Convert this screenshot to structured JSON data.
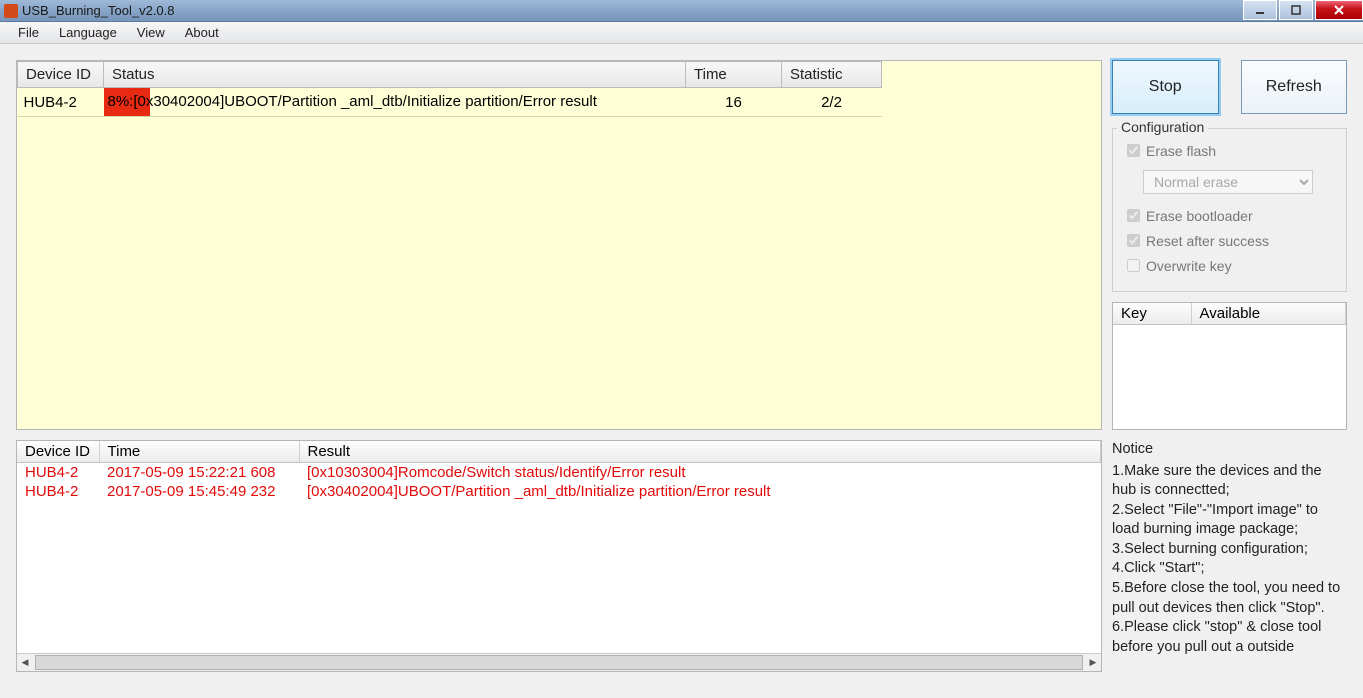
{
  "window": {
    "title": "USB_Burning_Tool_v2.0.8"
  },
  "menu": {
    "file": "File",
    "language": "Language",
    "view": "View",
    "about": "About"
  },
  "deviceTable": {
    "headers": {
      "id": "Device ID",
      "status": "Status",
      "time": "Time",
      "stat": "Statistic"
    },
    "row": {
      "id": "HUB4-2",
      "status": "8%:[0x30402004]UBOOT/Partition _aml_dtb/Initialize partition/Error result",
      "time": "16",
      "stat": "2/2",
      "progressPercent": "8"
    }
  },
  "logTable": {
    "headers": {
      "id": "Device ID",
      "time": "Time",
      "result": "Result"
    },
    "rows": [
      {
        "id": "HUB4-2",
        "time": "2017-05-09 15:22:21 608",
        "result": "[0x10303004]Romcode/Switch status/Identify/Error result"
      },
      {
        "id": "HUB4-2",
        "time": "2017-05-09 15:45:49 232",
        "result": "[0x30402004]UBOOT/Partition _aml_dtb/Initialize partition/Error result"
      }
    ]
  },
  "buttons": {
    "stop": "Stop",
    "refresh": "Refresh"
  },
  "config": {
    "legend": "Configuration",
    "eraseFlash": "Erase flash",
    "eraseMode": "Normal erase",
    "eraseBootloader": "Erase bootloader",
    "resetAfter": "Reset after success",
    "overwriteKey": "Overwrite key"
  },
  "keyTable": {
    "headers": {
      "key": "Key",
      "avail": "Available"
    }
  },
  "notice": {
    "title": "Notice",
    "l1": "1.Make sure the devices and the hub is connectted;",
    "l2": "2.Select \"File\"-\"Import image\" to load burning image package;",
    "l3": "3.Select burning configuration;",
    "l4": "4.Click \"Start\";",
    "l5": "5.Before close the tool, you need to pull out devices then click \"Stop\".",
    "l6": "6.Please click \"stop\" & close tool before you pull out a outside"
  }
}
